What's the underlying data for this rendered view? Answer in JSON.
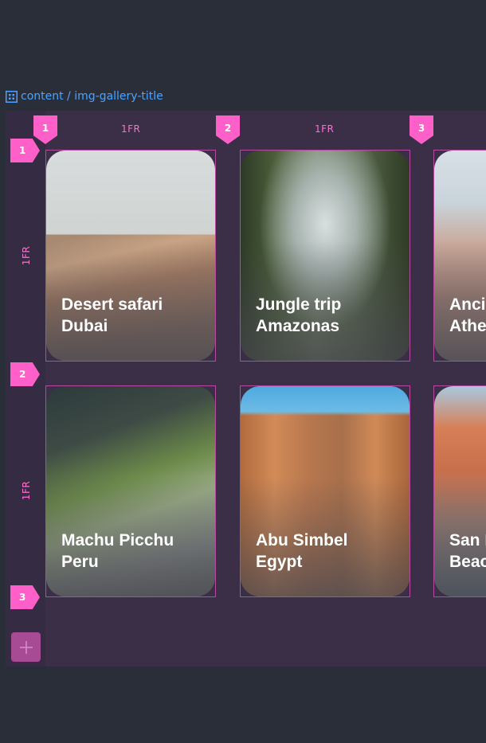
{
  "breadcrumb": {
    "path": "content / img-gallery-title",
    "icon": "grid-icon"
  },
  "grid": {
    "columns": [
      {
        "marker": "1"
      },
      {
        "marker": "2",
        "track": "1FR"
      },
      {
        "marker": "3",
        "track": "1FR"
      }
    ],
    "rows": [
      {
        "marker": "1"
      },
      {
        "marker": "2",
        "track": "1FR"
      },
      {
        "marker": "3",
        "track": "1FR"
      }
    ],
    "add_label": "+"
  },
  "cards": [
    {
      "line1": "Desert safari",
      "line2": "Dubai"
    },
    {
      "line1": "Jungle trip",
      "line2": "Amazonas"
    },
    {
      "line1": "Ancient",
      "line2": "Athens"
    },
    {
      "line1": "Machu Picchu",
      "line2": "Peru"
    },
    {
      "line1": "Abu Simbel",
      "line2": "Egypt"
    },
    {
      "line1": "San Remo",
      "line2": "Beach"
    }
  ],
  "colors": {
    "accent": "#ff5fc9",
    "link": "#4aa3ff",
    "panel": "#3a2f47",
    "background": "#2a2e39"
  }
}
